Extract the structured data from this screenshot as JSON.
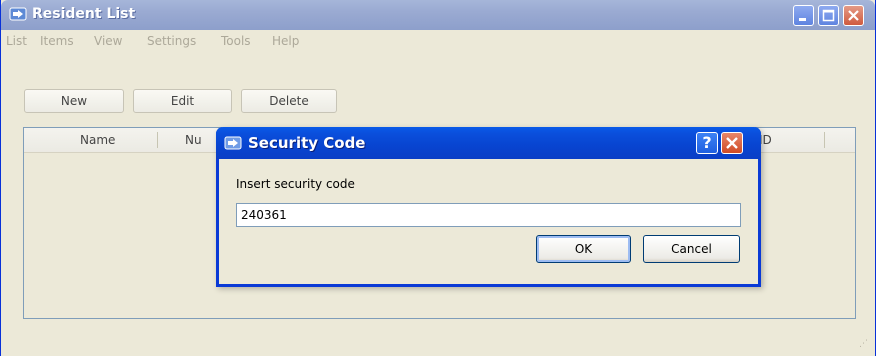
{
  "window": {
    "title": "Resident List"
  },
  "menu": [
    "List",
    "Items",
    "View",
    "Settings",
    "Tools",
    "Help"
  ],
  "toolbar": {
    "new_label": "New",
    "edit_label": "Edit",
    "delete_label": "Delete"
  },
  "table": {
    "columns": [
      "Name",
      "Nu",
      "ID"
    ]
  },
  "dialog": {
    "title": "Security Code",
    "help_label": "?",
    "prompt": "Insert security code",
    "code_value": "240361",
    "ok_label": "OK",
    "cancel_label": "Cancel"
  },
  "colors": {
    "dialog_title": "#0a4fdc",
    "window_title_inactive": "#9aaad2",
    "background": "#ece9d8"
  }
}
